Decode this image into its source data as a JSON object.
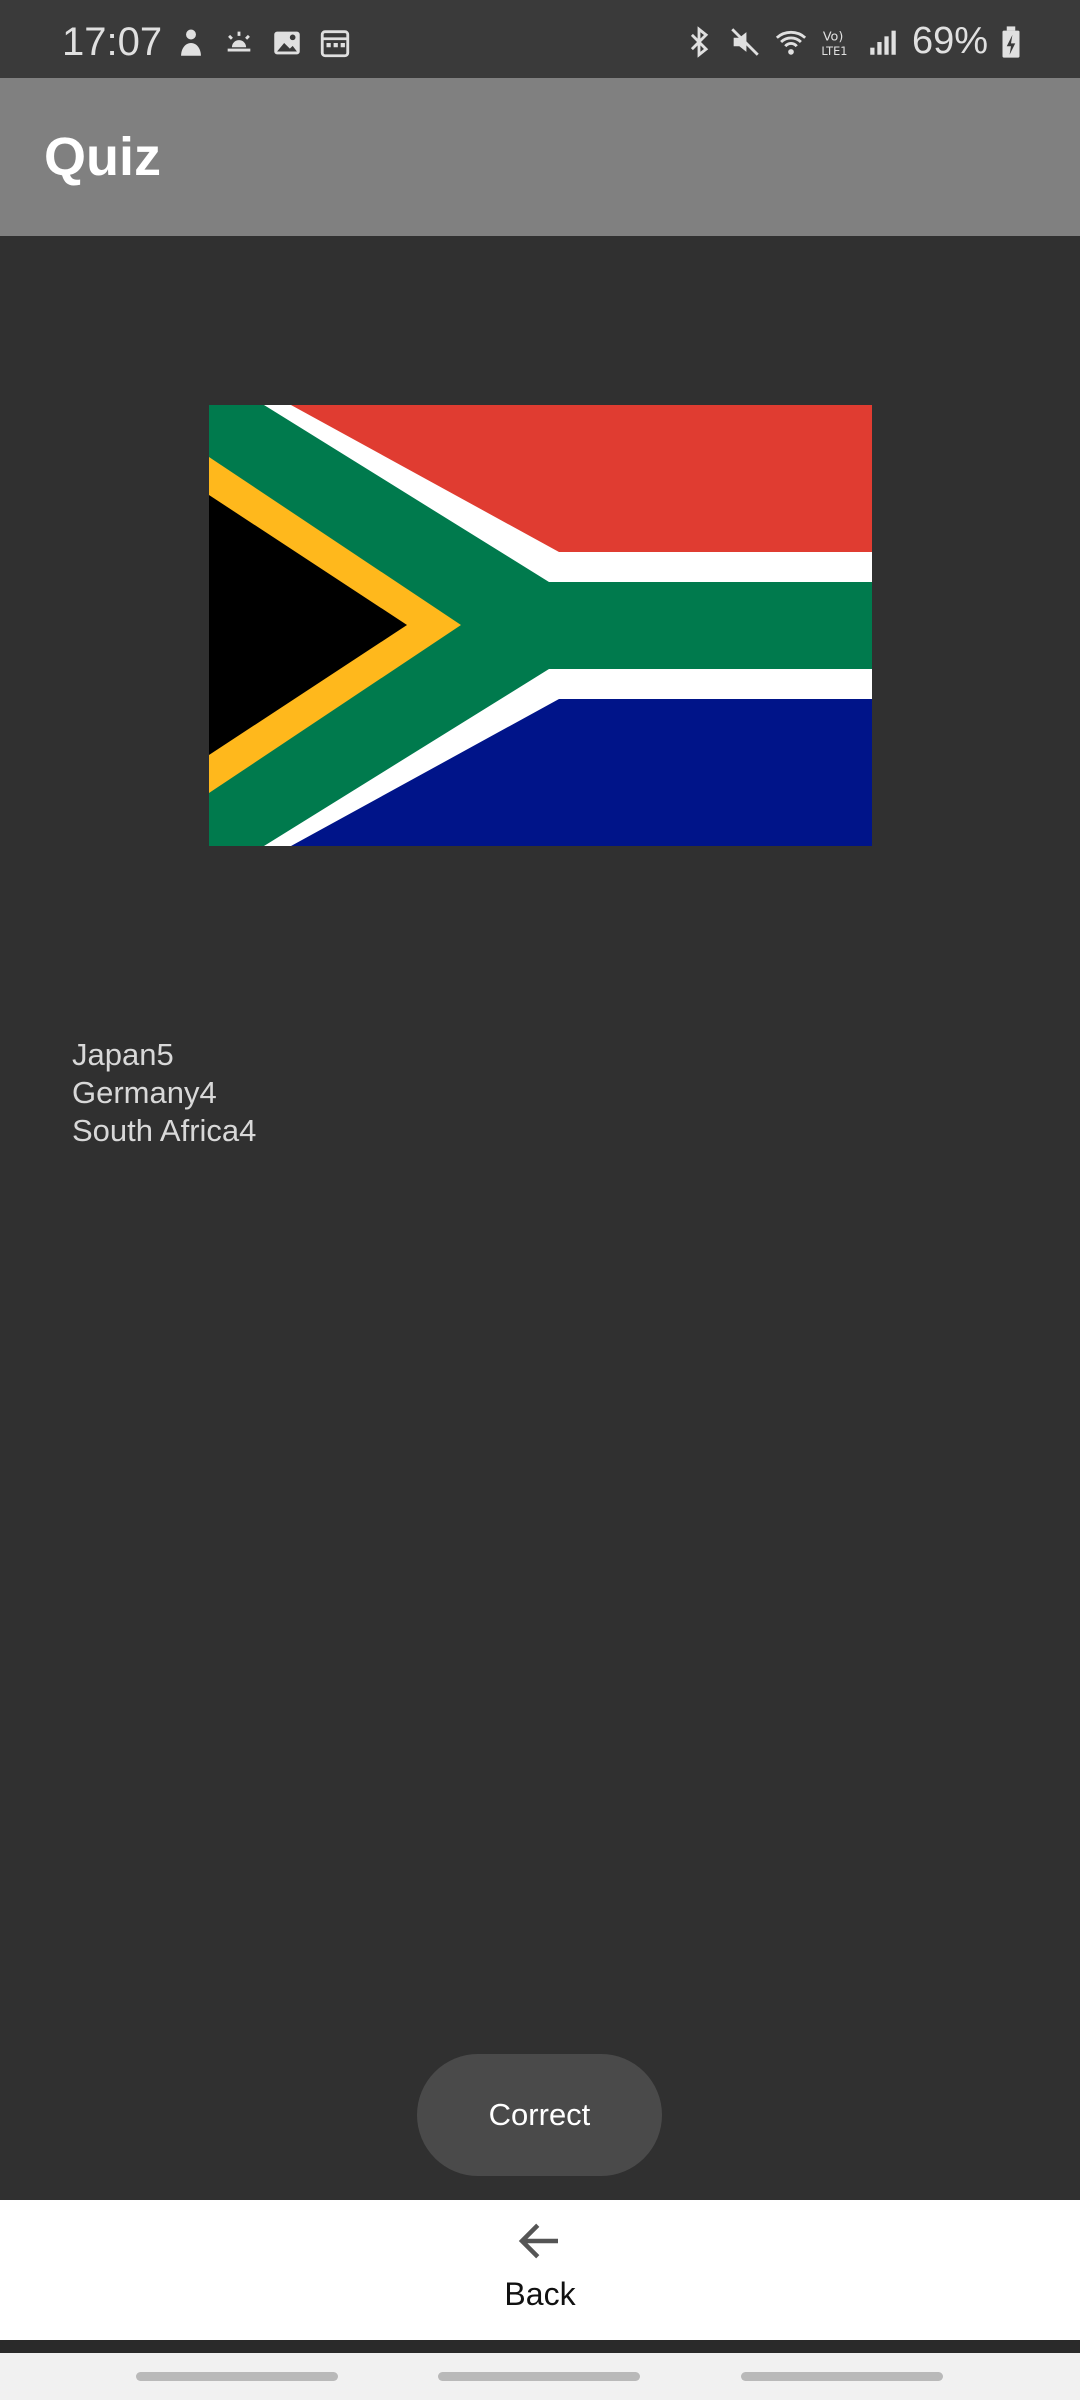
{
  "status_bar": {
    "time": "17:07",
    "battery": "69%",
    "left_icons": [
      "notification-person-icon",
      "weather-icon",
      "gallery-icon",
      "calendar-icon"
    ],
    "right_icons": [
      "bluetooth-icon",
      "mute-icon",
      "wifi-icon",
      "volte-icon",
      "signal-icon",
      "battery-icon"
    ]
  },
  "app_bar": {
    "title": "Quiz"
  },
  "flag": {
    "country": "South Africa",
    "icon": "south-africa-flag"
  },
  "scores": [
    {
      "text": "Japan5"
    },
    {
      "text": "Germany4"
    },
    {
      "text": "South Africa4"
    }
  ],
  "toast": {
    "text": "Correct"
  },
  "bottom_nav": {
    "back_label": "Back",
    "back_icon": "arrow-left-icon"
  },
  "colors": {
    "background": "#303030",
    "app_bar": "#808080",
    "toast": "#4a4a4a",
    "flag_red": "#E03C31",
    "flag_green": "#007A4D",
    "flag_blue": "#001489",
    "flag_gold": "#FFB81C"
  }
}
